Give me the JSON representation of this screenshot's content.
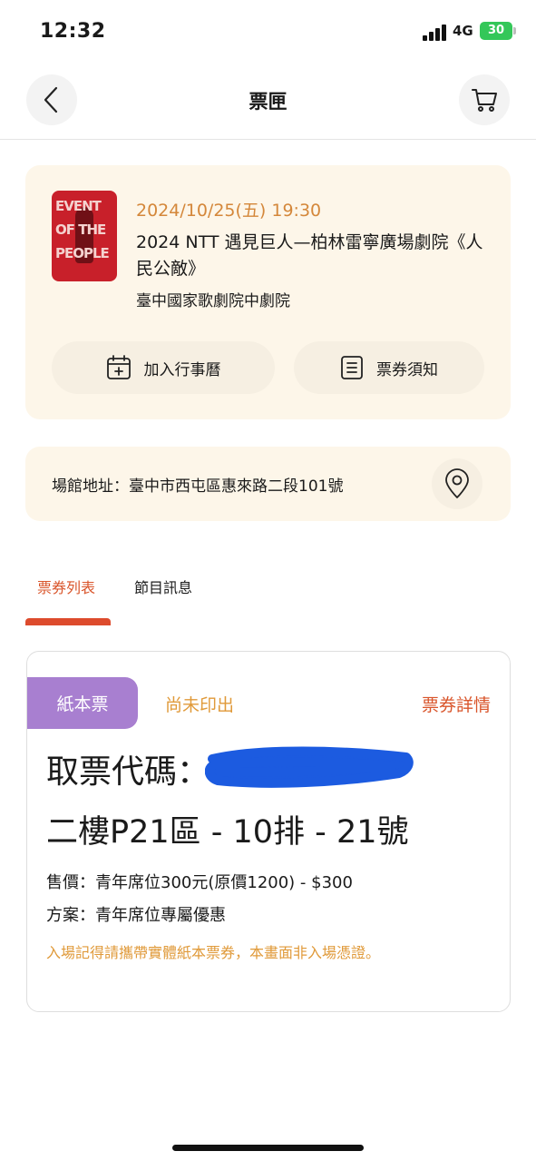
{
  "status_bar": {
    "time": "12:32",
    "network": "4G",
    "battery": "30"
  },
  "nav": {
    "title": "票匣",
    "back_icon": "chevron-left-icon",
    "cart_icon": "cart-icon"
  },
  "event": {
    "poster_lines": [
      "EVENT",
      "OF THE",
      "PEOPLE"
    ],
    "date": "2024/10/25(五) 19:30",
    "title": "2024 NTT 遇見巨人—柏林雷寧廣場劇院《人民公敵》",
    "venue": "臺中國家歌劇院中劇院",
    "add_calendar_label": "加入行事曆",
    "ticket_notice_label": "票券須知"
  },
  "address": {
    "text": "場館地址：臺中市西屯區惠來路二段101號",
    "pin_icon": "location-pin-icon"
  },
  "tabs": [
    {
      "label": "票券列表",
      "active": true
    },
    {
      "label": "節目訊息",
      "active": false
    }
  ],
  "ticket": {
    "type_badge": "紙本票",
    "status": "尚未印出",
    "detail_link": "票券詳情",
    "code_label": "取票代碼：",
    "seat": "二樓P21區 - 10排 - 21號",
    "price": "售價：青年席位300元(原價1200) - $300",
    "plan": "方案：青年席位專屬優惠",
    "note": "入場記得請攜帶實體紙本票券，本畫面非入場憑證。"
  },
  "colors": {
    "accent": "#dd4b2d",
    "card_bg": "#fdf6e9",
    "date_orange": "#d4873a",
    "badge_purple": "#a87fd0",
    "redaction_blue": "#1c5be0"
  }
}
